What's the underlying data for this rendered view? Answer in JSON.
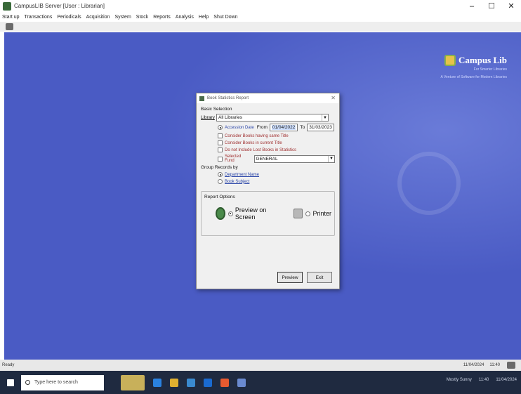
{
  "window": {
    "title": "CampusLIB Server [User : Librarian]",
    "minimize": "–",
    "maximize": "☐",
    "close": "✕"
  },
  "menu": [
    "Start up",
    "Transactions",
    "Periodicals",
    "Acquisition",
    "System",
    "Stock",
    "Reports",
    "Analysis",
    "Help",
    "Shut Down"
  ],
  "brand": {
    "name": "Campus Lib",
    "subtitle": "For Smarter Libraries",
    "tagline": "A Venture of Software for Modern Libraries"
  },
  "dialog": {
    "title": "Book Statistics Report",
    "section_basic": "Basic Selection",
    "library_label": "Library",
    "library_value": "All Libraries",
    "accession_date_label": "Accession Date",
    "from_label": "From",
    "from_value": "01/04/2022",
    "to_label": "To",
    "to_value": "31/03/2023",
    "opt1": "Consider Books having same Title",
    "opt2": "Consider Books in current Title",
    "opt3": "Do not Include Lost Books in Statistics",
    "selected_fund_label": "Selected Fund",
    "selected_fund_value": "GENERAL",
    "group_label": "Group Records by",
    "group_opt1": "Department Name",
    "group_opt2": "Book Subject",
    "print_label": "Report Options",
    "preview_label": "Preview on Screen",
    "printer_label": "Printer",
    "preview_btn": "Preview",
    "exit_btn": "Exit"
  },
  "status": {
    "left": "Ready",
    "date": "11/04/2024",
    "time": "11:40"
  },
  "taskbar": {
    "search_placeholder": "Type here to search",
    "weather": "Mostly Sunny",
    "clock_time": "11:40",
    "clock_date": "11/04/2024"
  }
}
